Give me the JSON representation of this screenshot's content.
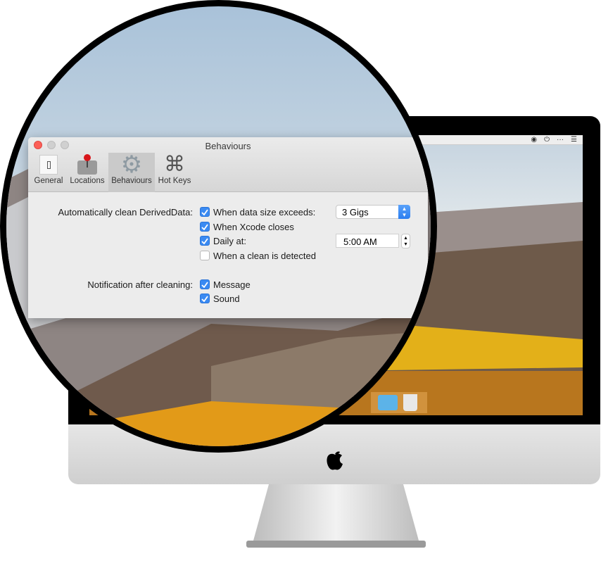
{
  "window": {
    "title": "Behaviours"
  },
  "toolbar": {
    "items": [
      {
        "label": "General",
        "icon": "switch-icon"
      },
      {
        "label": "Locations",
        "icon": "joystick-disk-icon"
      },
      {
        "label": "Behaviours",
        "icon": "gear-icon",
        "selected": true
      },
      {
        "label": "Hot Keys",
        "icon": "command-key-icon"
      }
    ]
  },
  "auto_clean": {
    "label": "Automatically clean DerivedData:",
    "options": [
      {
        "label": "When data size exceeds:",
        "checked": true
      },
      {
        "label": "When Xcode closes",
        "checked": true
      },
      {
        "label": "Daily at:",
        "checked": true
      },
      {
        "label": "When a clean is detected",
        "checked": false
      }
    ],
    "size_value": "3 Gigs",
    "time_value": "5:00 AM"
  },
  "notification": {
    "label": "Notification after cleaning:",
    "options": [
      {
        "label": "Message",
        "checked": true
      },
      {
        "label": "Sound",
        "checked": true
      }
    ]
  },
  "colors": {
    "accent": "#3a8af2",
    "close": "#fc5f57"
  }
}
